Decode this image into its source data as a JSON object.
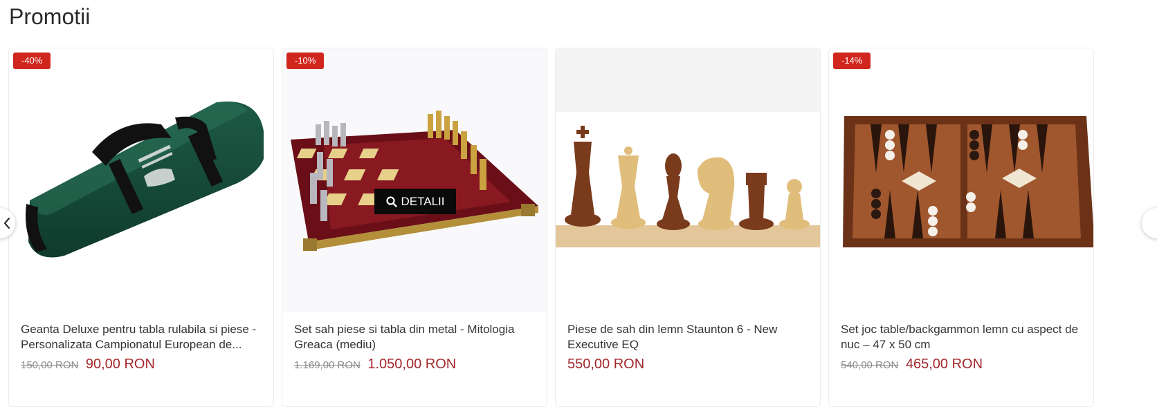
{
  "section": {
    "title": "Promotii"
  },
  "details_label": "DETALII",
  "products": [
    {
      "badge": "-40%",
      "title": "Geanta Deluxe pentru tabla rulabila si piese - Personalizata Campionatul European de...",
      "old_price": "150,00 RON",
      "price": "90,00 RON",
      "image": "green-chess-bag"
    },
    {
      "badge": "-10%",
      "title": "Set sah piese si tabla din metal - Mitologia Greaca (mediu)",
      "old_price": "1.169,00 RON",
      "price": "1.050,00 RON",
      "image": "metal-chess-set"
    },
    {
      "badge": "",
      "title": "Piese de sah din lemn Staunton 6 - New Executive EQ",
      "old_price": "",
      "price": "550,00 RON",
      "image": "wooden-chess-pieces"
    },
    {
      "badge": "-14%",
      "title": "Set joc table/backgammon lemn cu aspect de nuc – 47 x 50 cm",
      "old_price": "540,00 RON",
      "price": "465,00 RON",
      "image": "backgammon-board"
    }
  ],
  "colors": {
    "badge": "#d0261d",
    "price": "#a3262a",
    "old_price": "#8a8a8a"
  }
}
